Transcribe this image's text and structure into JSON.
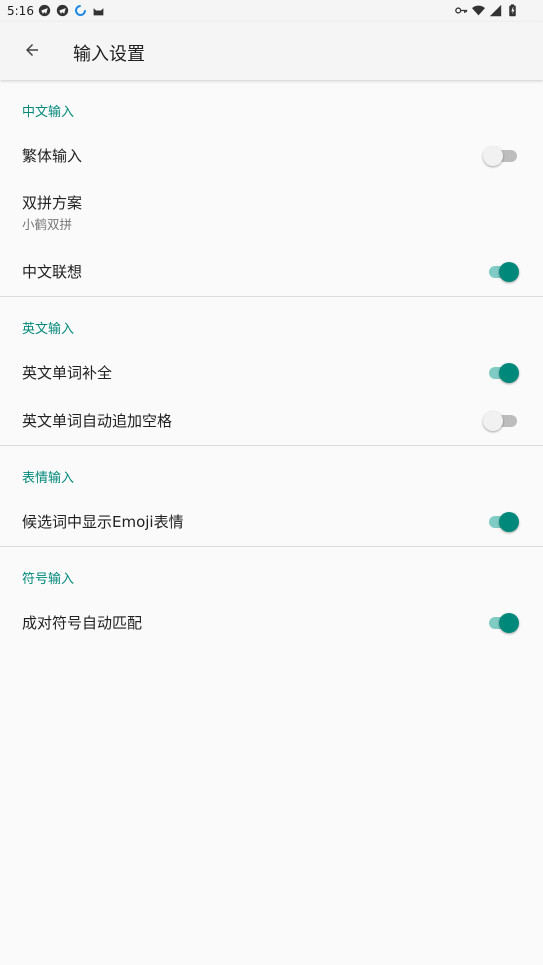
{
  "status_bar": {
    "time": "5:16",
    "left_icons": [
      "telegram-icon",
      "telegram-icon",
      "sync-icon",
      "cat-icon"
    ],
    "right_icons": [
      "key-icon",
      "wifi-icon",
      "signal-icon",
      "battery-icon"
    ]
  },
  "app_bar": {
    "title": "输入设置"
  },
  "sections": [
    {
      "header": "中文输入",
      "items": [
        {
          "label": "繁体输入",
          "switch": false
        },
        {
          "label": "双拼方案",
          "summary": "小鹤双拼"
        },
        {
          "label": "中文联想",
          "switch": true
        }
      ]
    },
    {
      "header": "英文输入",
      "items": [
        {
          "label": "英文单词补全",
          "switch": true
        },
        {
          "label": "英文单词自动追加空格",
          "switch": false
        }
      ]
    },
    {
      "header": "表情输入",
      "items": [
        {
          "label": "候选词中显示Emoji表情",
          "switch": true
        }
      ]
    },
    {
      "header": "符号输入",
      "items": [
        {
          "label": "成对符号自动匹配",
          "switch": true
        }
      ]
    }
  ],
  "colors": {
    "accent": "#00897b",
    "accent_track": "#80cbc4",
    "off_thumb": "#f1f1f1",
    "off_track": "#bdbdbd"
  }
}
